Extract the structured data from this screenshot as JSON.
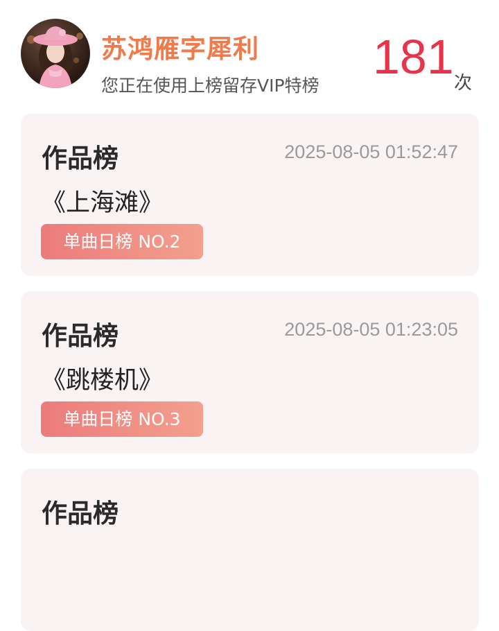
{
  "header": {
    "user_name": "苏鸿雁字犀利",
    "subtitle": "您正在使用上榜留存VIP特榜",
    "count": "181",
    "count_unit": "次",
    "colors": {
      "name": "#f07a4a",
      "count": "#e8344a"
    }
  },
  "records": [
    {
      "category": "作品榜",
      "time": "2025-08-05 01:52:47",
      "title": "《上海滩》",
      "badge": "单曲日榜 NO.2"
    },
    {
      "category": "作品榜",
      "time": "2025-08-05 01:23:05",
      "title": "《跳楼机》",
      "badge": "单曲日榜 NO.3"
    },
    {
      "category": "作品榜"
    }
  ]
}
